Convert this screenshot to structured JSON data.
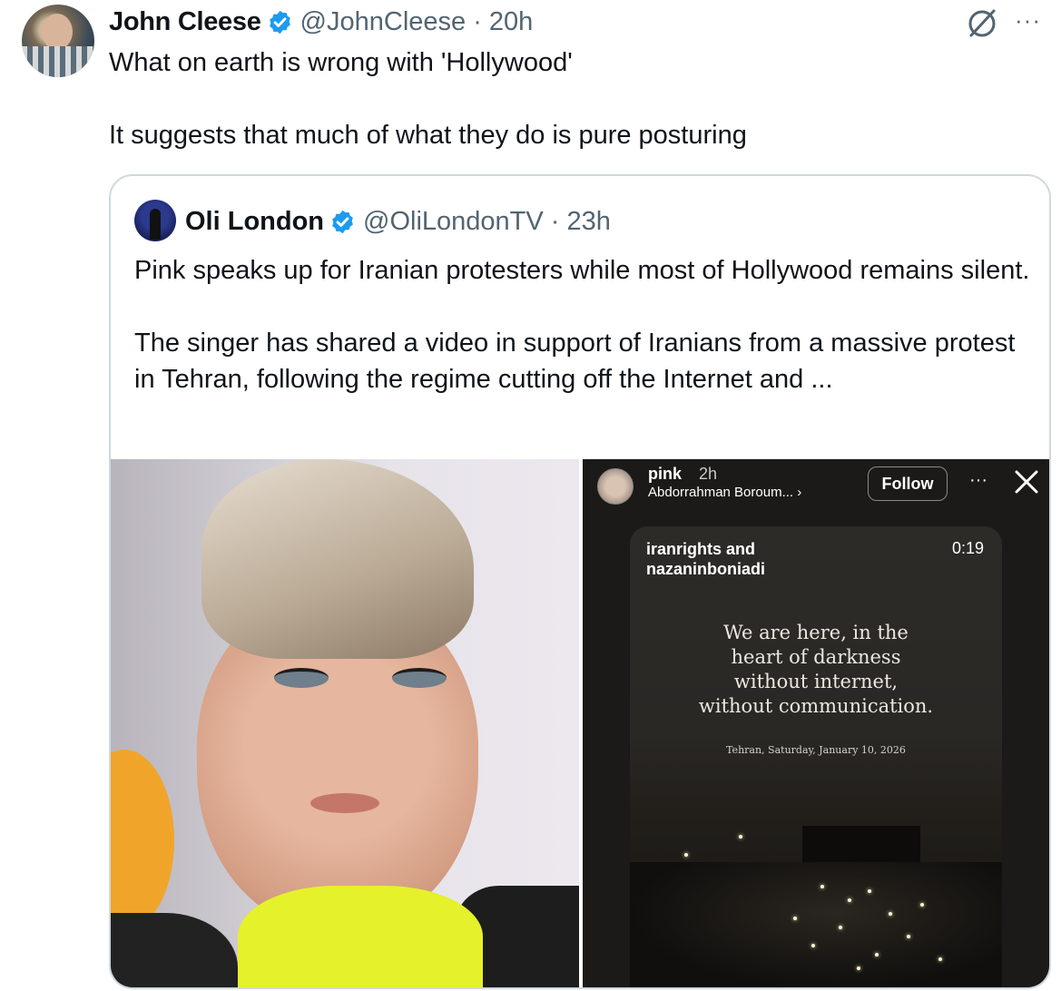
{
  "tweet": {
    "author_name": "John Cleese",
    "handle_time": "@JohnCleese · 20h",
    "text_line1": "What on earth is wrong with 'Hollywood'",
    "text_line2": "It suggests that much of what they do is pure posturing",
    "more_label": "···"
  },
  "quote": {
    "author_name": "Oli London",
    "handle_time": "@OliLondonTV · 23h",
    "text_para1": "Pink speaks up for Iranian protesters while most of Hollywood remains silent.",
    "text_para2": "The singer has shared a video in support of Iranians from a massive protest in Tehran, following the regime cutting off the Internet and ..."
  },
  "story": {
    "username": "pink",
    "time": "2h",
    "music": "Abdorrahman Boroum... ›",
    "follow_label": "Follow",
    "more_label": "···",
    "reel_user": "iranrights and nazaninboniadi",
    "reel_time": "0:19",
    "quote_lines": [
      "We are here, in the",
      "heart of darkness",
      "without internet,",
      "without communication."
    ],
    "caption": "Tehran, Saturday, January 10, 2026"
  },
  "colors": {
    "verified": "#1d9bf0",
    "secondary_text": "#536471",
    "border": "#cfd9de"
  }
}
